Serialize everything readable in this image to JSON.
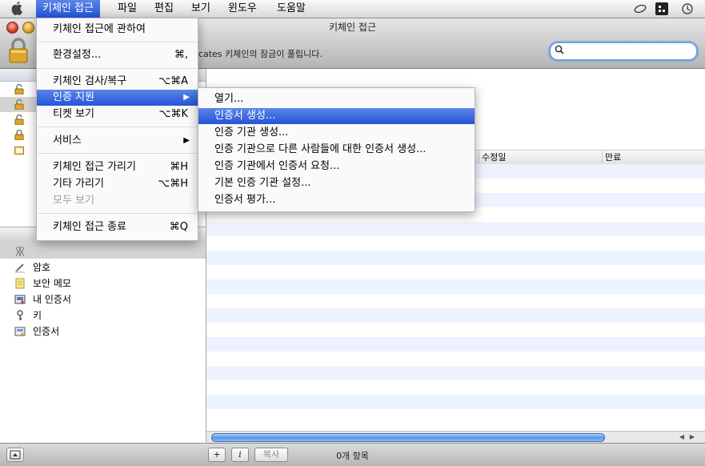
{
  "menubar": {
    "apple": "",
    "items": [
      "키체인 접근",
      "파일",
      "편집",
      "보기",
      "윈도우",
      "도움말"
    ],
    "active_index": 0
  },
  "window": {
    "title": "키체인 접근",
    "unlock_message": "ficates 키체인의 잠금이 풀립니다.",
    "search": {
      "value": "",
      "placeholder": ""
    }
  },
  "sidebar": {
    "keychains": [
      {
        "label": "",
        "icon": "lock-open-icon"
      },
      {
        "label": "",
        "icon": "lock-open-icon",
        "selected": true
      },
      {
        "label": "",
        "icon": "lock-open-icon"
      },
      {
        "label": "",
        "icon": "lock-closed-icon"
      },
      {
        "label": "",
        "icon": "folder-icon"
      }
    ],
    "categories": [
      {
        "label": "",
        "icon": "all-items-icon",
        "selected": true
      },
      {
        "label": "암호",
        "icon": "password-icon"
      },
      {
        "label": "보안 메모",
        "icon": "secure-note-icon"
      },
      {
        "label": "내 인증서",
        "icon": "my-certificate-icon"
      },
      {
        "label": "키",
        "icon": "key-icon"
      },
      {
        "label": "인증서",
        "icon": "certificate-icon"
      }
    ]
  },
  "table": {
    "columns": [
      "수정일",
      "만료"
    ]
  },
  "bottombar": {
    "add": "+",
    "info": "i",
    "copy": "복사",
    "item_count": "0개 항목"
  },
  "app_menu": {
    "items": [
      {
        "label": "키체인 접근에 관하여",
        "shortcut": ""
      },
      {
        "label": "환경설정...",
        "shortcut": "⌘,"
      },
      {
        "label": "키체인 검사/복구",
        "shortcut": "⌥⌘A"
      },
      {
        "label": "인증 지원",
        "shortcut": "",
        "submenu": true,
        "highlighted": true
      },
      {
        "label": "티켓 보기",
        "shortcut": "⌥⌘K"
      },
      {
        "label": "서비스",
        "shortcut": "",
        "submenu": true
      },
      {
        "label": "키체인 접근 가리기",
        "shortcut": "⌘H"
      },
      {
        "label": "기타 가리기",
        "shortcut": "⌥⌘H"
      },
      {
        "label": "모두 보기",
        "shortcut": "",
        "disabled": true
      },
      {
        "label": "키체인 접근 종료",
        "shortcut": "⌘Q"
      }
    ]
  },
  "cert_submenu": {
    "items": [
      {
        "label": "열기..."
      },
      {
        "label": "인증서 생성...",
        "highlighted": true
      },
      {
        "label": "인증 기관 생성..."
      },
      {
        "label": "인증 기관으로 다른 사람들에 대한 인증서 생성..."
      },
      {
        "label": "인증 기관에서 인증서 요청..."
      },
      {
        "label": "기본 인증 기관 설정..."
      },
      {
        "label": "인증서 평가..."
      }
    ]
  },
  "colors": {
    "highlight": "#2f5fdc",
    "stripe": "#edf3fe"
  }
}
